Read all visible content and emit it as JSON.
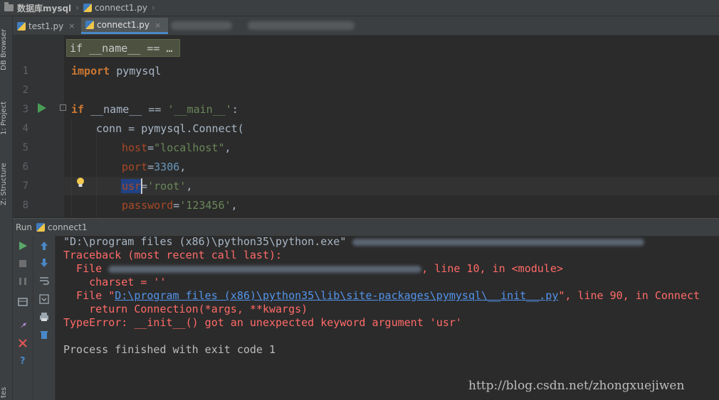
{
  "breadcrumb": {
    "project": "数据库mysql",
    "file": "connect1.py"
  },
  "side_tools": {
    "db_browser": "DB Browser",
    "project": "1: Project",
    "structure": "Z: Structure",
    "favorites": "tes"
  },
  "tabs": [
    {
      "label": "test1.py"
    },
    {
      "label": "connect1.py"
    }
  ],
  "close_glyph": "×",
  "hint": "if __name__ == …",
  "editor": {
    "line_numbers": [
      "1",
      "2",
      "3",
      "4",
      "5",
      "6",
      "7",
      "8"
    ],
    "lines": {
      "l1_kw": "import",
      "l1_rest": " pymysql",
      "l3_kw": "if",
      "l3_mid": " __name__ == ",
      "l3_str": "'__main__'",
      "l3_end": ":",
      "l4": "conn = pymysql.Connect(",
      "l5_p": "host",
      "l5_eq": "=",
      "l5_s": "\"localhost\"",
      "l5_c": ",",
      "l6_p": "port",
      "l6_eq": "=",
      "l6_n": "3306",
      "l6_c": ",",
      "l7_p": "usr",
      "l7_eq": "=",
      "l7_s": "'root'",
      "l7_c": ",",
      "l8_p": "password",
      "l8_eq": "=",
      "l8_s": "'123456'",
      "l8_c": ","
    }
  },
  "run_panel": {
    "title": "Run",
    "config": "connect1",
    "lines": {
      "cmd": "\"D:\\program files (x86)\\python35\\python.exe\"",
      "tb_head": "Traceback (most recent call last):",
      "file1_pre": "  File ",
      "file1_post": ", line 10, in <module>",
      "charset": "    charset = ''",
      "file2_pre": "  File \"",
      "file2_link": "D:\\program files (x86)\\python35\\lib\\site-packages\\pymysql\\__init__.py",
      "file2_post": "\", line 90, in Connect",
      "ret": "    return Connection(*args, **kwargs)",
      "err": "TypeError: __init__() got an unexpected keyword argument 'usr'",
      "done": "Process finished with exit code 1"
    }
  },
  "watermark": "http://blog.csdn.net/zhongxuejiwen",
  "colors": {
    "keyword": "#cc7832",
    "string": "#6a8759",
    "number": "#6897bb",
    "param": "#aa4926",
    "error": "#ff6b68",
    "link": "#5394ec"
  }
}
